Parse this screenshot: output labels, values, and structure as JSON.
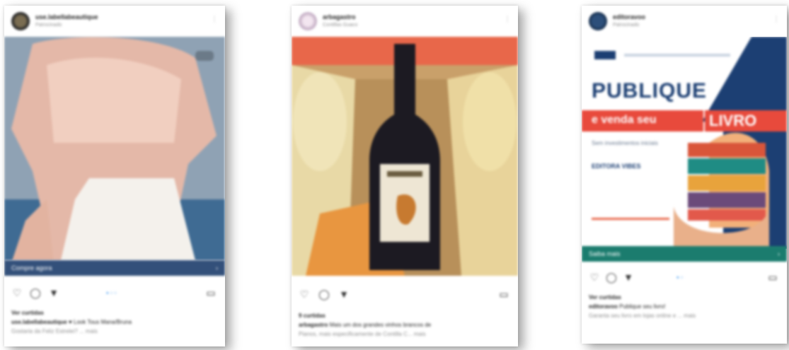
{
  "posts": [
    {
      "username": "use.labellabeautique",
      "subtitle": "Patrocinado",
      "cta": "Compre agora",
      "likes": "Ver curtidas",
      "caption_user": "use.labellabeautique",
      "caption_text": "♥ Look Tous Mana/Bruna",
      "caption_more": "Gostaria da Feliz Estrelei? ... mais",
      "colors": {
        "cta_bg": "#33507a"
      }
    },
    {
      "username": "arbagastro",
      "subtitle": "Contillas Guaco",
      "cta": "",
      "likes": "9 curtidas",
      "caption_user": "arbagastro",
      "caption_text": "Mais um dos grandes vinhos brancos de",
      "caption_more": "Pianos, mais especificamente de Contilla C... mais",
      "colors": {
        "cta_bg": ""
      }
    },
    {
      "username": "editoravoo",
      "subtitle": "Patrocinado",
      "ad_headline": "PUBLIQUE",
      "ad_tagline": "e venda seu",
      "ad_word": "LIVRO",
      "ad_body": "Sem investimentos iniciais",
      "ad_brand": "EDITORA VIBES",
      "cta": "Saiba mais",
      "likes": "Ver curtidas",
      "caption_user": "editoravoo",
      "caption_text": "Publique seu livro!",
      "caption_more": "Garanta seu livro em lojas online e ... mais",
      "colors": {
        "cta_bg": "#1b7c6e",
        "accent": "#e84a3c",
        "brand": "#1c3f73"
      }
    }
  ]
}
